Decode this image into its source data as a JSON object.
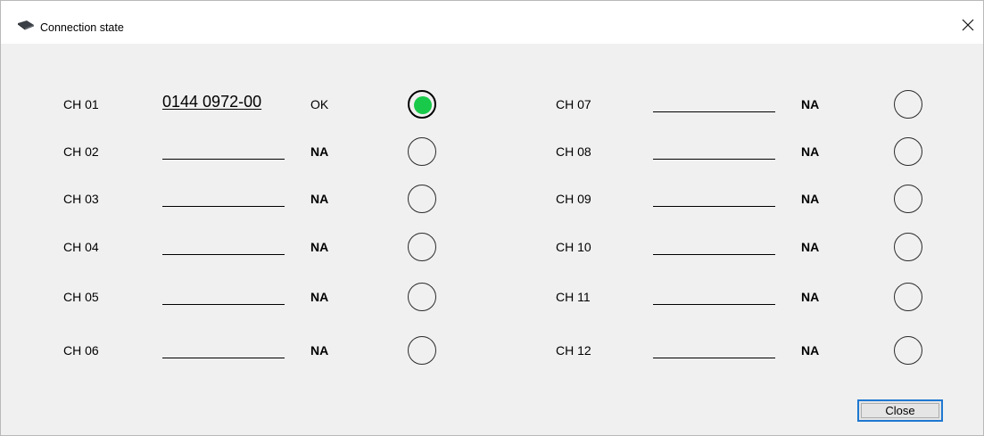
{
  "window": {
    "title": "Connection state",
    "icon": "device-icon",
    "close_icon": "close-icon"
  },
  "colors": {
    "ok": "#19c94a",
    "na": "transparent",
    "focus_border": "#1f78d1"
  },
  "channels_left": [
    {
      "label": "CH 01",
      "serial": "0144 0972-00",
      "status": "OK",
      "connected": true
    },
    {
      "label": "CH 02",
      "serial": "",
      "status": "NA",
      "connected": false
    },
    {
      "label": "CH 03",
      "serial": "",
      "status": "NA",
      "connected": false
    },
    {
      "label": "CH 04",
      "serial": "",
      "status": "NA",
      "connected": false
    },
    {
      "label": "CH 05",
      "serial": "",
      "status": "NA",
      "connected": false
    },
    {
      "label": "CH 06",
      "serial": "",
      "status": "NA",
      "connected": false
    }
  ],
  "channels_right": [
    {
      "label": "CH 07",
      "serial": "",
      "status": "NA",
      "connected": false
    },
    {
      "label": "CH 08",
      "serial": "",
      "status": "NA",
      "connected": false
    },
    {
      "label": "CH 09",
      "serial": "",
      "status": "NA",
      "connected": false
    },
    {
      "label": "CH 10",
      "serial": "",
      "status": "NA",
      "connected": false
    },
    {
      "label": "CH 11",
      "serial": "",
      "status": "NA",
      "connected": false
    },
    {
      "label": "CH 12",
      "serial": "",
      "status": "NA",
      "connected": false
    }
  ],
  "footer": {
    "close_label": "Close"
  }
}
